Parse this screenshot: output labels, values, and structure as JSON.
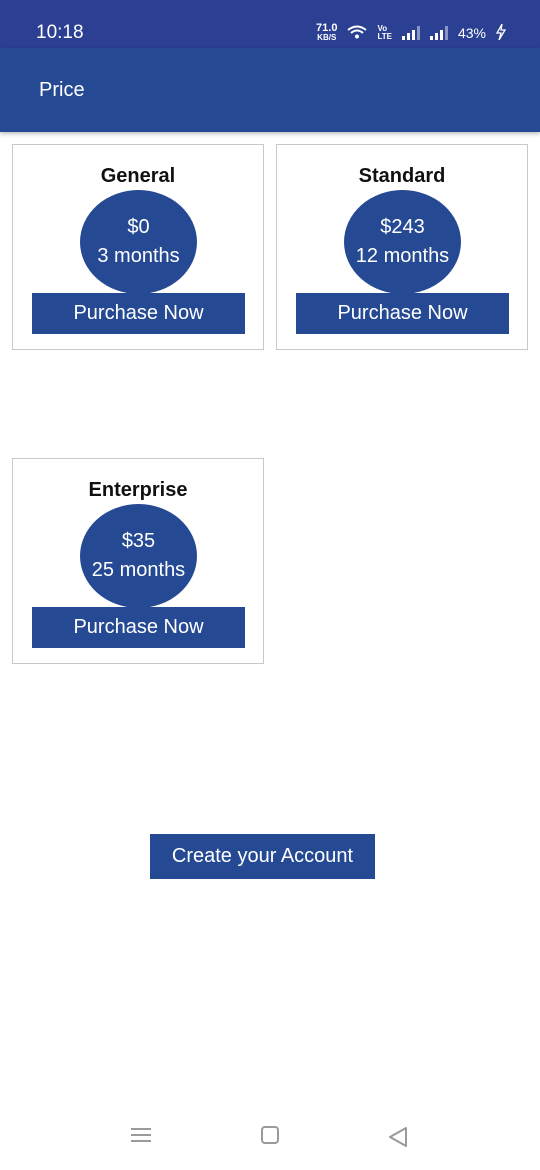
{
  "status_bar": {
    "time": "10:18",
    "net_speed_value": "71.0",
    "net_speed_unit": "KB/S",
    "volte_line1": "Vo",
    "volte_line2": "LTE",
    "battery": "43%",
    "icons": [
      "wifi-icon",
      "signal-icon",
      "signal-icon",
      "charging-icon"
    ]
  },
  "app_bar": {
    "title": "Price"
  },
  "plans": [
    {
      "name": "General",
      "price": "$0",
      "duration": "3 months",
      "button_label": "Purchase Now"
    },
    {
      "name": "Standard",
      "price": "$243",
      "duration": "12 months",
      "button_label": "Purchase Now"
    },
    {
      "name": "Enterprise",
      "price": "$35",
      "duration": "25 months",
      "button_label": "Purchase Now"
    }
  ],
  "create_account": {
    "label": "Create your Account"
  },
  "nav": {
    "icons": [
      "recent-apps-icon",
      "home-icon",
      "back-icon"
    ]
  },
  "colors": {
    "status_bar": "#2b3f93",
    "primary": "#254a93",
    "background": "#ffffff",
    "border": "#c8c8c8"
  }
}
